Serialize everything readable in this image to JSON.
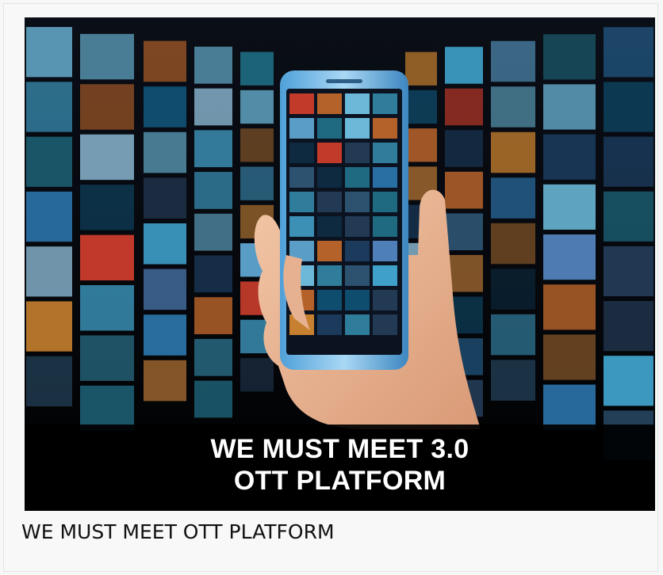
{
  "card": {
    "image_overlay_line1": "WE MUST MEET 3.0",
    "image_overlay_line2": "OTT PLATFORM",
    "caption": "WE MUST MEET OTT PLATFORM"
  },
  "colors": {
    "background": "#f8f8f8",
    "thumbnail_bg": "#000000",
    "caption_text": "#111111",
    "overlay_text": "#ffffff"
  },
  "icons": [
    "smartphone-illustration",
    "hand-illustration",
    "video-wall-illustration"
  ]
}
